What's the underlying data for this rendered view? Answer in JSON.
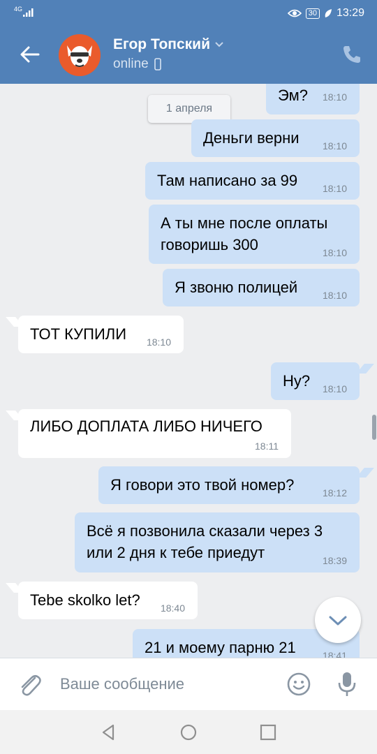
{
  "status_bar": {
    "network": "4G",
    "battery": "30",
    "time": "13:29"
  },
  "header": {
    "contact_name": "Егор Топский",
    "presence": "online"
  },
  "date_separator": "1 апреля",
  "messages": [
    {
      "dir": "out",
      "lines": [
        "Эм?"
      ],
      "time": "18:10"
    },
    {
      "dir": "out",
      "lines": [
        "Деньги верни"
      ],
      "time": "18:10"
    },
    {
      "dir": "out",
      "lines": [
        "Там написано за 99"
      ],
      "time": "18:10"
    },
    {
      "dir": "out",
      "lines": [
        "А ты мне после оплаты",
        "говоришь 300"
      ],
      "time": "18:10"
    },
    {
      "dir": "out",
      "lines": [
        "Я звоню полицей"
      ],
      "time": "18:10"
    },
    {
      "dir": "in",
      "lines": [
        "ТОТ КУПИЛИ"
      ],
      "time": "18:10"
    },
    {
      "dir": "out",
      "lines": [
        "Ну?"
      ],
      "time": "18:10"
    },
    {
      "dir": "in",
      "lines": [
        "ЛИБО ДОПЛАТА ЛИБО НИЧЕГО"
      ],
      "time": "18:11"
    },
    {
      "dir": "out",
      "lines": [
        "Я говори это твой номер?"
      ],
      "time": "18:12"
    },
    {
      "dir": "out",
      "lines": [
        "Всё я позвонила сказали через 3",
        "или 2 дня к тебе приедут"
      ],
      "time": "18:39"
    },
    {
      "dir": "in",
      "lines": [
        "Tebe skolko let?"
      ],
      "time": "18:40"
    },
    {
      "dir": "out",
      "lines": [
        "21 и моему парню 21"
      ],
      "time": "18:41"
    }
  ],
  "composer": {
    "placeholder": "Ваше сообщение"
  },
  "icons": {
    "back": "arrow-left-icon",
    "call": "phone-icon",
    "attach": "paperclip-icon",
    "emoji": "smile-icon",
    "mic": "microphone-icon",
    "scroll_down": "chevron-down-icon"
  },
  "colors": {
    "header": "#5181b8",
    "bubble_out": "#cce0f7",
    "bubble_in": "#ffffff",
    "background": "#edeef0"
  }
}
